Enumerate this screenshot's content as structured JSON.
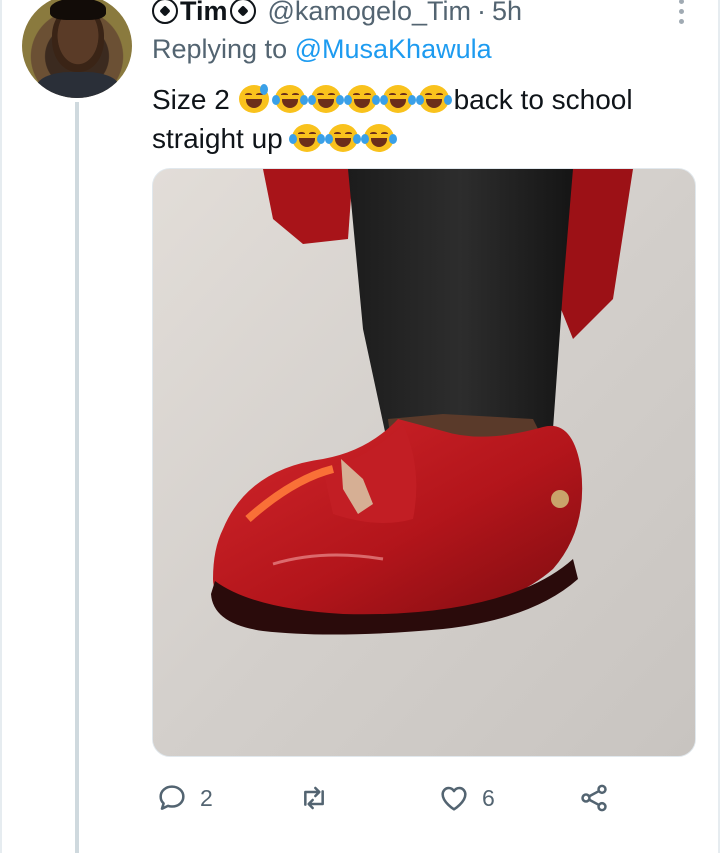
{
  "tweet": {
    "display_name": "Tim",
    "handle": "@kamogelo_Tim",
    "separator": "·",
    "time": "5h",
    "replying_prefix": "Replying to",
    "replying_to": "@MusaKhawula",
    "text_part1": "Size 2",
    "text_part2": "back to school",
    "text_part3": "straight up",
    "media_alt": "red loafer shoe photo"
  },
  "actions": {
    "reply_count": "2",
    "retweet_count": "",
    "like_count": "6"
  },
  "icons": {
    "name_badge": "soccer-ball-icon",
    "reply": "reply-bubble-icon",
    "retweet": "retweet-icon",
    "like": "heart-icon",
    "share": "share-icon",
    "more": "more-vertical-icon"
  },
  "colors": {
    "text": "#0f1419",
    "secondary": "#536471",
    "link": "#1d9bf0",
    "thread_line": "#cfd9de",
    "shoe_red": "#b3151b"
  }
}
